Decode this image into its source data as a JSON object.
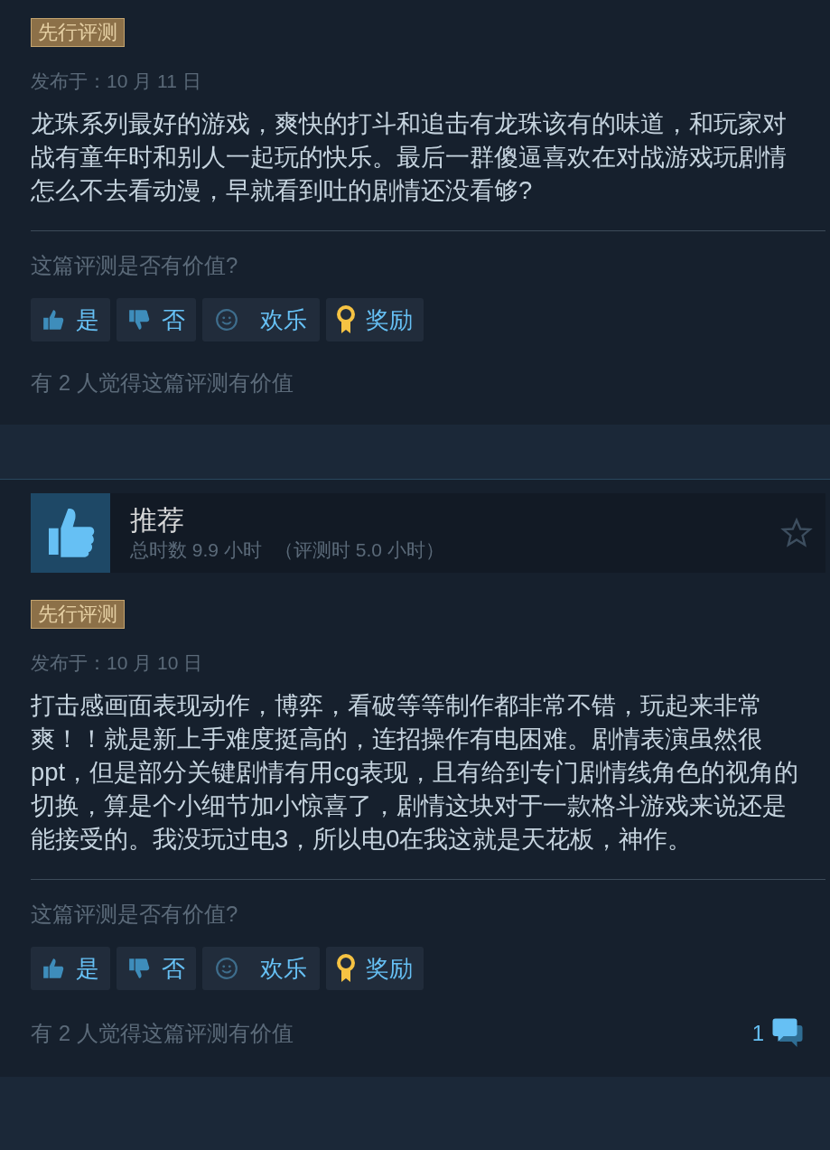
{
  "reviews": [
    {
      "badge": "先行评测",
      "posted": "发布于：10 月 11 日",
      "body": "龙珠系列最好的游戏，爽快的打斗和追击有龙珠该有的味道，和玩家对战有童年时和别人一起玩的快乐。最后一群傻逼喜欢在对战游戏玩剧情怎么不去看动漫，早就看到吐的剧情还没看够?",
      "question": "这篇评测是否有价值?",
      "buttons": [
        {
          "kind": "yes",
          "label": "是"
        },
        {
          "kind": "no",
          "label": "否"
        },
        {
          "kind": "funny",
          "label": "欢乐"
        },
        {
          "kind": "award",
          "label": "奖励"
        }
      ],
      "helpful": "有 2 人觉得这篇评测有价值"
    },
    {
      "header": {
        "recommended": true,
        "title": "推荐",
        "hours": "总时数 9.9 小时",
        "at_review": "（评测时 5.0 小时）"
      },
      "badge": "先行评测",
      "posted": "发布于：10 月 10 日",
      "body": "打击感画面表现动作，博弈，看破等等制作都非常不错，玩起来非常爽！！就是新上手难度挺高的，连招操作有电困难。剧情表演虽然很ppt，但是部分关键剧情有用cg表现，且有给到专门剧情线角色的视角的切换，算是个小细节加小惊喜了，剧情这块对于一款格斗游戏来说还是能接受的。我没玩过电3，所以电0在我这就是天花板，神作。",
      "question": "这篇评测是否有价值?",
      "buttons": [
        {
          "kind": "yes",
          "label": "是"
        },
        {
          "kind": "no",
          "label": "否"
        },
        {
          "kind": "funny",
          "label": "欢乐"
        },
        {
          "kind": "award",
          "label": "奖励"
        }
      ],
      "helpful": "有 2 人觉得这篇评测有价值",
      "comments": "1"
    }
  ]
}
